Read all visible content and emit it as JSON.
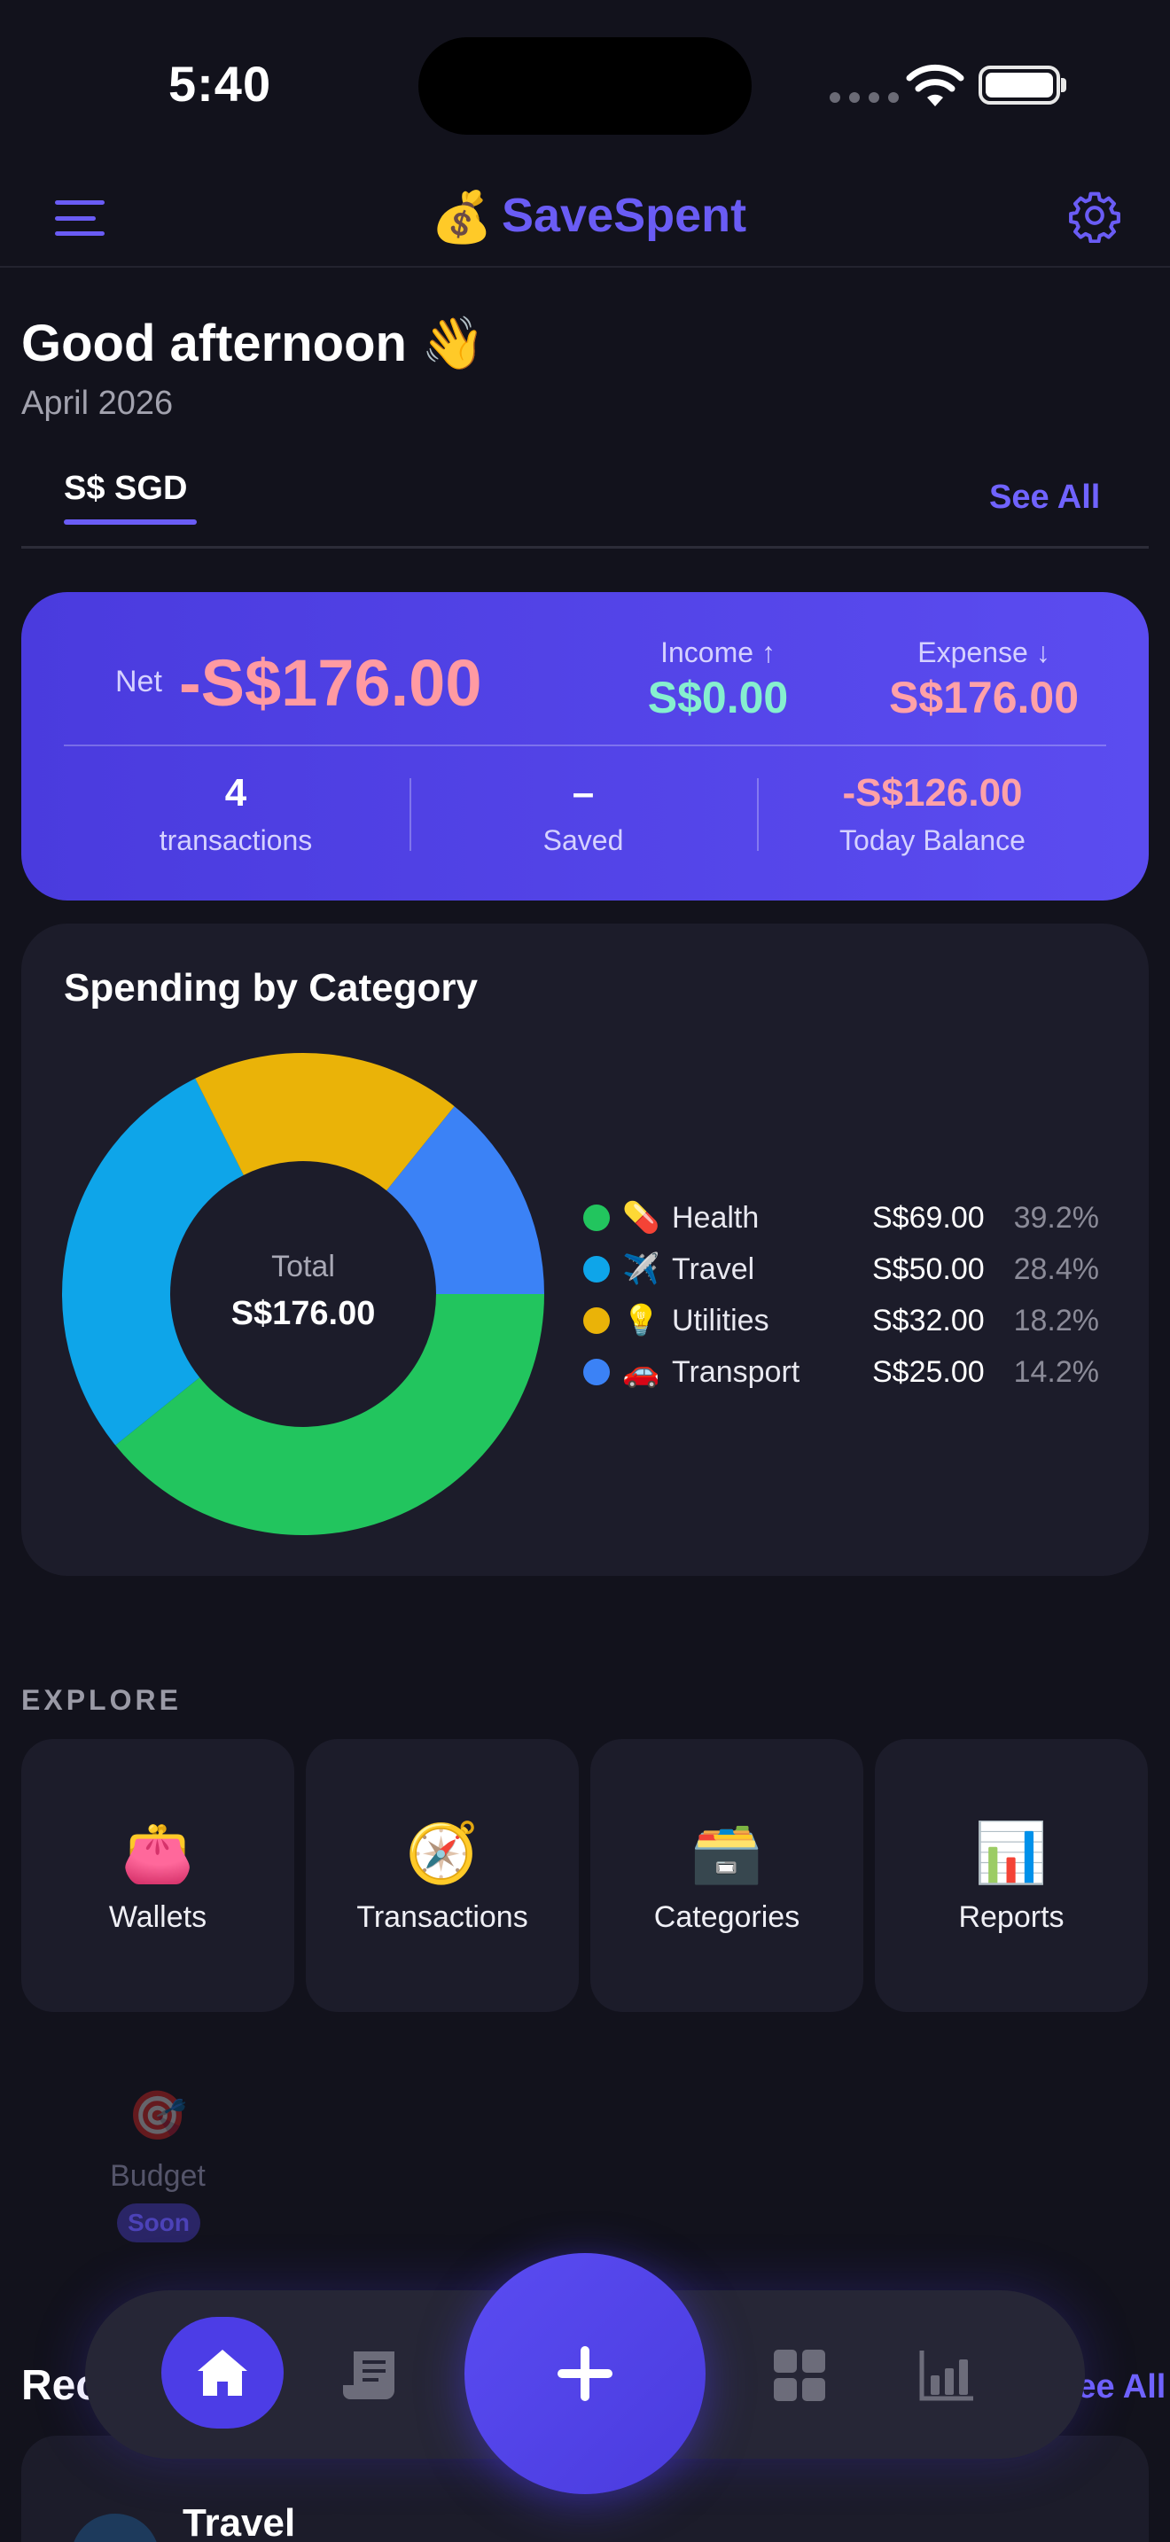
{
  "status_bar": {
    "time": "5:40"
  },
  "header": {
    "brand_emoji": "💰",
    "brand_name": "SaveSpent"
  },
  "greeting": {
    "text": "Good afternoon 👋",
    "period": "April 2026"
  },
  "tabs": {
    "active": "S$ SGD",
    "see_all": "See All"
  },
  "summary": {
    "net_label": "Net",
    "net_value": "-S$176.00",
    "income_label": "Income ↑",
    "income_value": "S$0.00",
    "expense_label": "Expense ↓",
    "expense_value": "S$176.00",
    "stats": [
      {
        "value": "4",
        "label": "transactions"
      },
      {
        "value": "–",
        "label": "Saved"
      },
      {
        "value": "-S$126.00",
        "label": "Today Balance"
      }
    ]
  },
  "spending": {
    "title": "Spending by Category",
    "center_label": "Total",
    "center_value": "S$176.00"
  },
  "chart_data": {
    "type": "pie",
    "title": "Spending by Category",
    "categories": [
      "Health",
      "Travel",
      "Utilities",
      "Transport"
    ],
    "values": [
      69.0,
      50.0,
      32.0,
      25.0
    ],
    "amounts": [
      "S$69.00",
      "S$50.00",
      "S$32.00",
      "S$25.00"
    ],
    "percents": [
      "39.2%",
      "28.4%",
      "18.2%",
      "14.2%"
    ],
    "emojis": [
      "💊",
      "✈️",
      "💡",
      "🚗"
    ],
    "colors": [
      "#22c55e",
      "#0ea5e9",
      "#eab308",
      "#3b82f6"
    ],
    "legend_position": "right"
  },
  "explore": {
    "title": "EXPLORE",
    "tiles": [
      {
        "emoji": "👛",
        "label": "Wallets"
      },
      {
        "emoji": "🧭",
        "label": "Transactions"
      },
      {
        "emoji": "🗃️",
        "label": "Categories"
      },
      {
        "emoji": "📊",
        "label": "Reports"
      }
    ],
    "budget": {
      "emoji": "🎯",
      "label": "Budget",
      "badge": "Soon"
    }
  },
  "recent": {
    "title": "Recent",
    "see_all": "See All",
    "first_item": "Travel"
  }
}
